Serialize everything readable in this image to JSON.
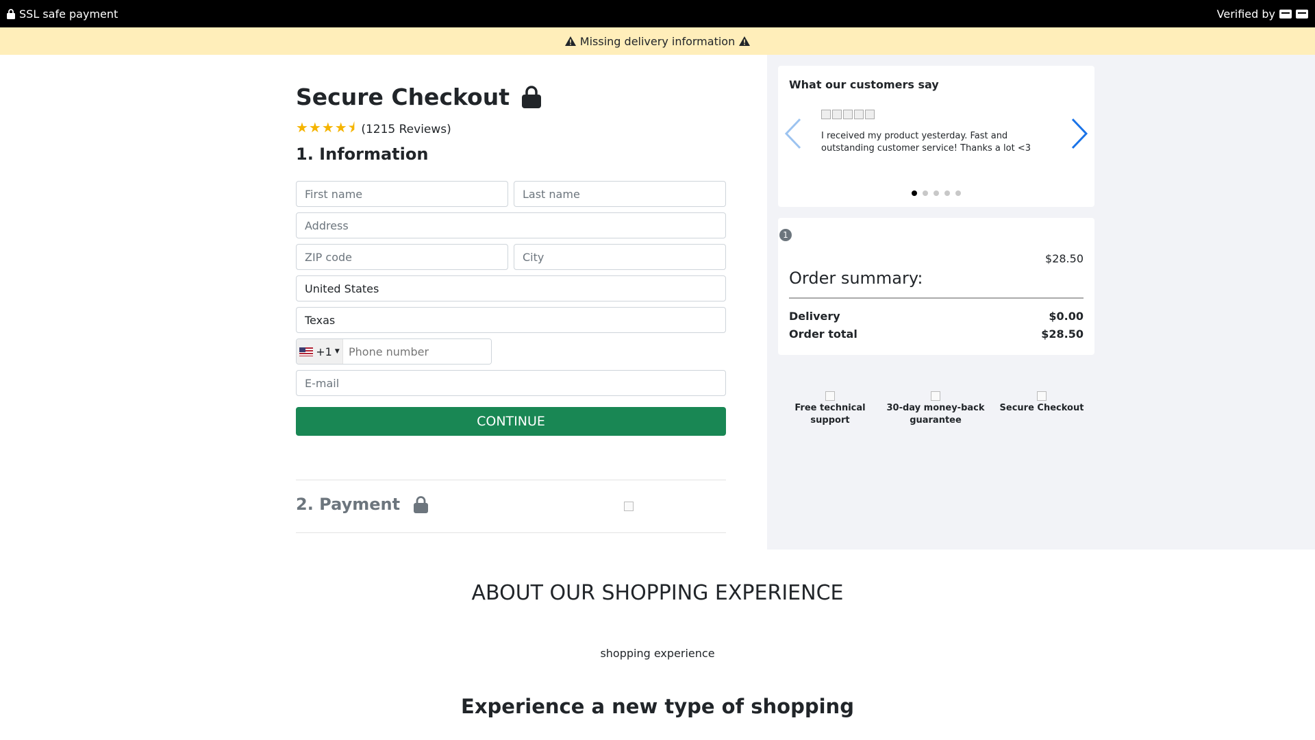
{
  "topbar": {
    "left_text": "SSL safe payment",
    "right_text": "Verified by"
  },
  "warning": {
    "text": "Missing delivery information"
  },
  "checkout": {
    "title": "Secure Checkout",
    "rating": {
      "value": 4.5,
      "reviews_text": "(1215 Reviews)"
    },
    "section_title": "1. Information",
    "fields": {
      "first_name": "First name",
      "last_name": "Last name",
      "address": "Address",
      "zip": "ZIP code",
      "city": "City",
      "country": "United States",
      "state": "Texas",
      "phone_code": "+1",
      "phone_placeholder": "Phone number",
      "email": "E-mail"
    },
    "continue_label": "CONTINUE",
    "payment_title": "2. Payment"
  },
  "reviews": {
    "title": "What our customers say",
    "text": "I received my product yesterday. Fast and outstanding customer service! Thanks a lot <3",
    "dots": 5,
    "active_dot": 0
  },
  "summary": {
    "badge": "1",
    "item_price": "$28.50",
    "title": "Order summary:",
    "delivery_label": "Delivery",
    "delivery_value": "$0.00",
    "total_label": "Order total",
    "total_value": "$28.50"
  },
  "features": [
    {
      "line1": "Free technical",
      "line2": "support"
    },
    {
      "line1": "30-day money-back",
      "line2": "guarantee"
    },
    {
      "line1": "Secure Checkout",
      "line2": ""
    }
  ],
  "about": {
    "title": "ABOUT OUR SHOPPING EXPERIENCE",
    "image_alt": "shopping experience",
    "subtitle": "Experience a new type of shopping"
  },
  "colors": {
    "continue": "#198754",
    "warning_bg": "#ffeeba",
    "star": "#f5b400",
    "arrow": "#1a73e8"
  }
}
